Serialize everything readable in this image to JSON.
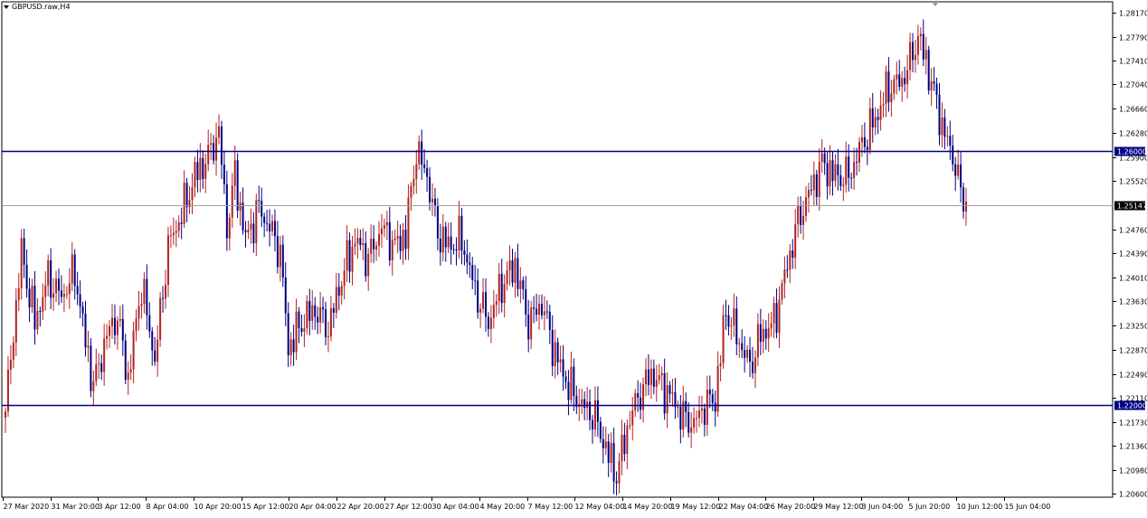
{
  "window": {
    "title": "GBPUSD.raw,H4"
  },
  "colors": {
    "background": "#ffffff",
    "axis": "#000000",
    "up_candle": "#b22222",
    "down_candle": "#000080",
    "level_line": "#000080",
    "current_price_line": "#a0a0a0",
    "level_label_bg": "#000080",
    "price_label_bg": "#000000"
  },
  "chart_data": {
    "type": "candlestick",
    "symbol": "GBPUSD.raw",
    "timeframe": "H4",
    "ylim": [
      1.2055,
      1.2834
    ],
    "y_ticks": [
      "1.28170",
      "1.27790",
      "1.27410",
      "1.27040",
      "1.26660",
      "1.26280",
      "1.25900",
      "1.25520",
      "1.24760",
      "1.24390",
      "1.24010",
      "1.23630",
      "1.23250",
      "1.22870",
      "1.22490",
      "1.22110",
      "1.21730",
      "1.21360",
      "1.20980",
      "1.20600"
    ],
    "x_ticks": [
      "27 Mar 2020",
      "31 Mar 20:00",
      "3 Apr 12:00",
      "8 Apr 04:00",
      "10 Apr 20:00",
      "15 Apr 12:00",
      "20 Apr 04:00",
      "22 Apr 20:00",
      "27 Apr 12:00",
      "30 Apr 04:00",
      "4 May 20:00",
      "7 May 12:00",
      "12 May 04:00",
      "14 May 20:00",
      "19 May 12:00",
      "22 May 04:00",
      "26 May 20:00",
      "29 May 12:00",
      "3 Jun 04:00",
      "5 Jun 20:00",
      "10 Jun 12:00",
      "15 Jun 04:00"
    ],
    "horizontal_levels": [
      {
        "price": "1.26000",
        "value": 1.26
      },
      {
        "price": "1.22000",
        "value": 1.22
      }
    ],
    "current_price": {
      "label": "1.25147",
      "value": 1.25147
    },
    "close_path": [
      [
        0,
        1.219
      ],
      [
        6,
        1.244
      ],
      [
        11,
        1.233
      ],
      [
        16,
        1.24
      ],
      [
        21,
        1.237
      ],
      [
        26,
        1.241
      ],
      [
        30,
        1.23
      ],
      [
        33,
        1.223
      ],
      [
        38,
        1.231
      ],
      [
        42,
        1.234
      ],
      [
        46,
        1.224
      ],
      [
        51,
        1.239
      ],
      [
        56,
        1.227
      ],
      [
        61,
        1.245
      ],
      [
        66,
        1.25
      ],
      [
        71,
        1.256
      ],
      [
        76,
        1.259
      ],
      [
        80,
        1.263
      ],
      [
        83,
        1.248
      ],
      [
        86,
        1.256
      ],
      [
        90,
        1.246
      ],
      [
        95,
        1.251
      ],
      [
        100,
        1.247
      ],
      [
        103,
        1.244
      ],
      [
        106,
        1.229
      ],
      [
        111,
        1.233
      ],
      [
        116,
        1.235
      ],
      [
        121,
        1.232
      ],
      [
        126,
        1.24
      ],
      [
        131,
        1.246
      ],
      [
        136,
        1.243
      ],
      [
        141,
        1.248
      ],
      [
        146,
        1.245
      ],
      [
        150,
        1.247
      ],
      [
        154,
        1.26
      ],
      [
        158,
        1.256
      ],
      [
        162,
        1.247
      ],
      [
        166,
        1.245
      ],
      [
        171,
        1.246
      ],
      [
        176,
        1.238
      ],
      [
        181,
        1.233
      ],
      [
        186,
        1.239
      ],
      [
        191,
        1.242
      ],
      [
        196,
        1.233
      ],
      [
        201,
        1.236
      ],
      [
        206,
        1.228
      ],
      [
        211,
        1.223
      ],
      [
        216,
        1.22
      ],
      [
        221,
        1.218
      ],
      [
        226,
        1.212
      ],
      [
        229,
        1.209
      ],
      [
        234,
        1.218
      ],
      [
        238,
        1.222
      ],
      [
        242,
        1.225
      ],
      [
        246,
        1.223
      ],
      [
        250,
        1.221
      ],
      [
        254,
        1.218
      ],
      [
        258,
        1.217
      ],
      [
        262,
        1.22
      ],
      [
        266,
        1.221
      ],
      [
        270,
        1.235
      ],
      [
        275,
        1.23
      ],
      [
        279,
        1.226
      ],
      [
        283,
        1.231
      ],
      [
        288,
        1.233
      ],
      [
        293,
        1.242
      ],
      [
        297,
        1.249
      ],
      [
        301,
        1.253
      ],
      [
        306,
        1.258
      ],
      [
        311,
        1.256
      ],
      [
        316,
        1.256
      ],
      [
        321,
        1.261
      ],
      [
        326,
        1.265
      ],
      [
        331,
        1.27
      ],
      [
        336,
        1.271
      ],
      [
        339,
        1.274
      ],
      [
        342,
        1.278
      ],
      [
        345,
        1.274
      ],
      [
        348,
        1.269
      ],
      [
        351,
        1.264
      ],
      [
        354,
        1.26
      ],
      [
        356,
        1.258
      ],
      [
        358,
        1.253
      ],
      [
        360,
        1.252
      ]
    ]
  }
}
